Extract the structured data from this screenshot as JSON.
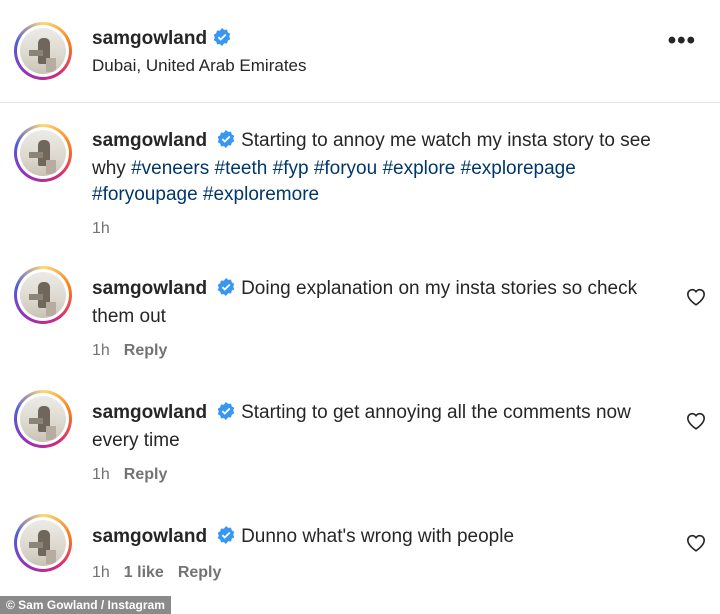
{
  "post": {
    "username": "samgowland",
    "location": "Dubai, United Arab Emirates",
    "more_icon": "more-horizontal-icon"
  },
  "caption": {
    "username": "samgowland",
    "text": "Starting to annoy me watch my insta story to see why",
    "hashtags": "#veneers #teeth #fyp #foryou #explore #explorepage #foryoupage #exploremore",
    "time": "1h"
  },
  "comments": [
    {
      "username": "samgowland",
      "text": "Doing explanation on my insta stories so check them out",
      "time": "1h",
      "likes": "",
      "reply": "Reply"
    },
    {
      "username": "samgowland",
      "text": "Starting to get annoying all the comments now every time",
      "time": "1h",
      "likes": "",
      "reply": "Reply"
    },
    {
      "username": "samgowland",
      "text": "Dunno what's wrong with people",
      "time": "1h",
      "likes": "1 like",
      "reply": "Reply"
    }
  ],
  "credit": "© Sam Gowland / Instagram",
  "colors": {
    "verified": "#3897f0",
    "hashtag": "#00376b",
    "muted": "#737373"
  }
}
